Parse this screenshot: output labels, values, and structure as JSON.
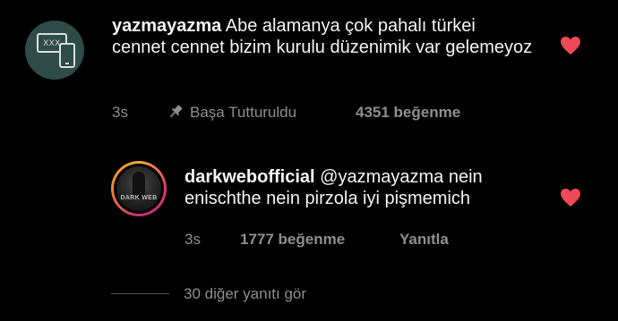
{
  "comment": {
    "username": "yazmayazma",
    "text": "Abe alamanya çok pahalı türkei cennet cennet bizim kurulu düzenimik var gelemeyoz",
    "time": "3s",
    "pinned_label": "Başa Tutturuldu",
    "likes": "4351 beğenme",
    "avatar_text": "XXX"
  },
  "reply": {
    "username": "darkwebofficial",
    "mention": "@yazmayazma",
    "text": "nein enischthe nein pirzola iyi pişmemich",
    "time": "3s",
    "likes": "1777 beğenme",
    "reply_label": "Yanıtla",
    "avatar_text": "DARK WEB"
  },
  "more_replies": "30 diğer yanıtı gör",
  "colors": {
    "heart": "#ed4956",
    "meta": "#8e8e8e",
    "background": "#000000"
  }
}
